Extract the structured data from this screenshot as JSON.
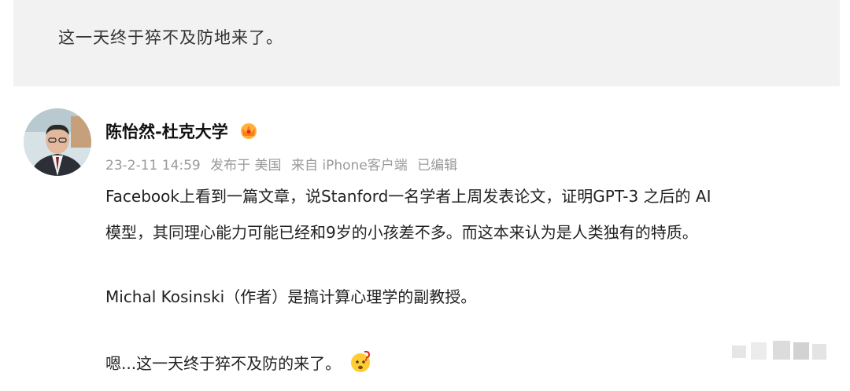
{
  "quote": {
    "text": "这一天终于猝不及防地来了。"
  },
  "post": {
    "author": "陈怡然-杜克大学",
    "date": "23-2-11 14:59",
    "location": "发布于 美国",
    "source": "来自 iPhone客户端",
    "edited": "已编辑",
    "lines": [
      "Facebook上看到一篇文章，说Stanford一名学者上周发表论文，证明GPT-3 之后的 AI",
      "模型，其同理心能力可能已经和9岁的小孩差不多。而这本来认为是人类独有的特质。",
      "Michal Kosinski（作者）是搞计算心理学的副教授。",
      "嗯...这一天终于猝不及防的来了。"
    ],
    "badge_icon": "vip-crown-icon",
    "end_emoji": "thinking-emoji-icon"
  }
}
